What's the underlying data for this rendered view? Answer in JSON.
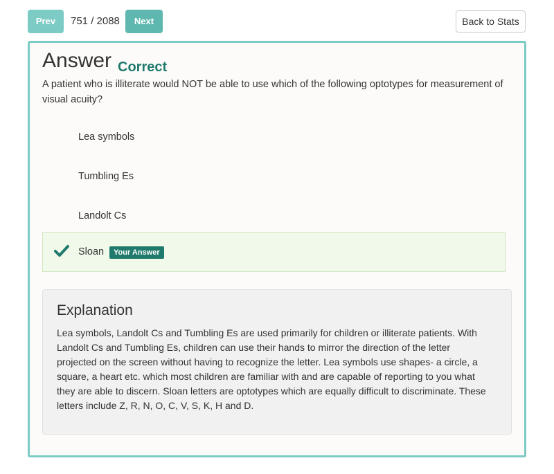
{
  "nav": {
    "prev_label": "Prev",
    "counter": "751 / 2088",
    "next_label": "Next",
    "back_label": "Back to Stats"
  },
  "card": {
    "heading": "Answer",
    "result": "Correct",
    "question": "A patient who is illiterate would NOT be able to use which of the following optotypes for measurement of visual acuity?",
    "options": [
      {
        "label": "Lea symbols"
      },
      {
        "label": "Tumbling Es"
      },
      {
        "label": "Landolt Cs"
      },
      {
        "label": "Sloan",
        "badge": "Your Answer",
        "icon": "check-icon"
      }
    ],
    "explanation": {
      "title": "Explanation",
      "text": "Lea symbols, Landolt Cs and Tumbling Es are used primarily for children or illiterate patients. With Landolt Cs and Tumbling Es, children can use their hands to mirror the direction of the letter projected on the screen without having to recognize the letter. Lea symbols use shapes- a circle, a square, a heart etc. which most children are familiar with and are capable of reporting to you what they are able to discern. Sloan letters are optotypes which are equally difficult to discriminate. These letters include Z, R, N, O, C, V, S, K, H and D."
    }
  },
  "colors": {
    "accent": "#7ccbc5",
    "correct": "#1f7a6c",
    "selected_bg": "#f0f9ea"
  }
}
